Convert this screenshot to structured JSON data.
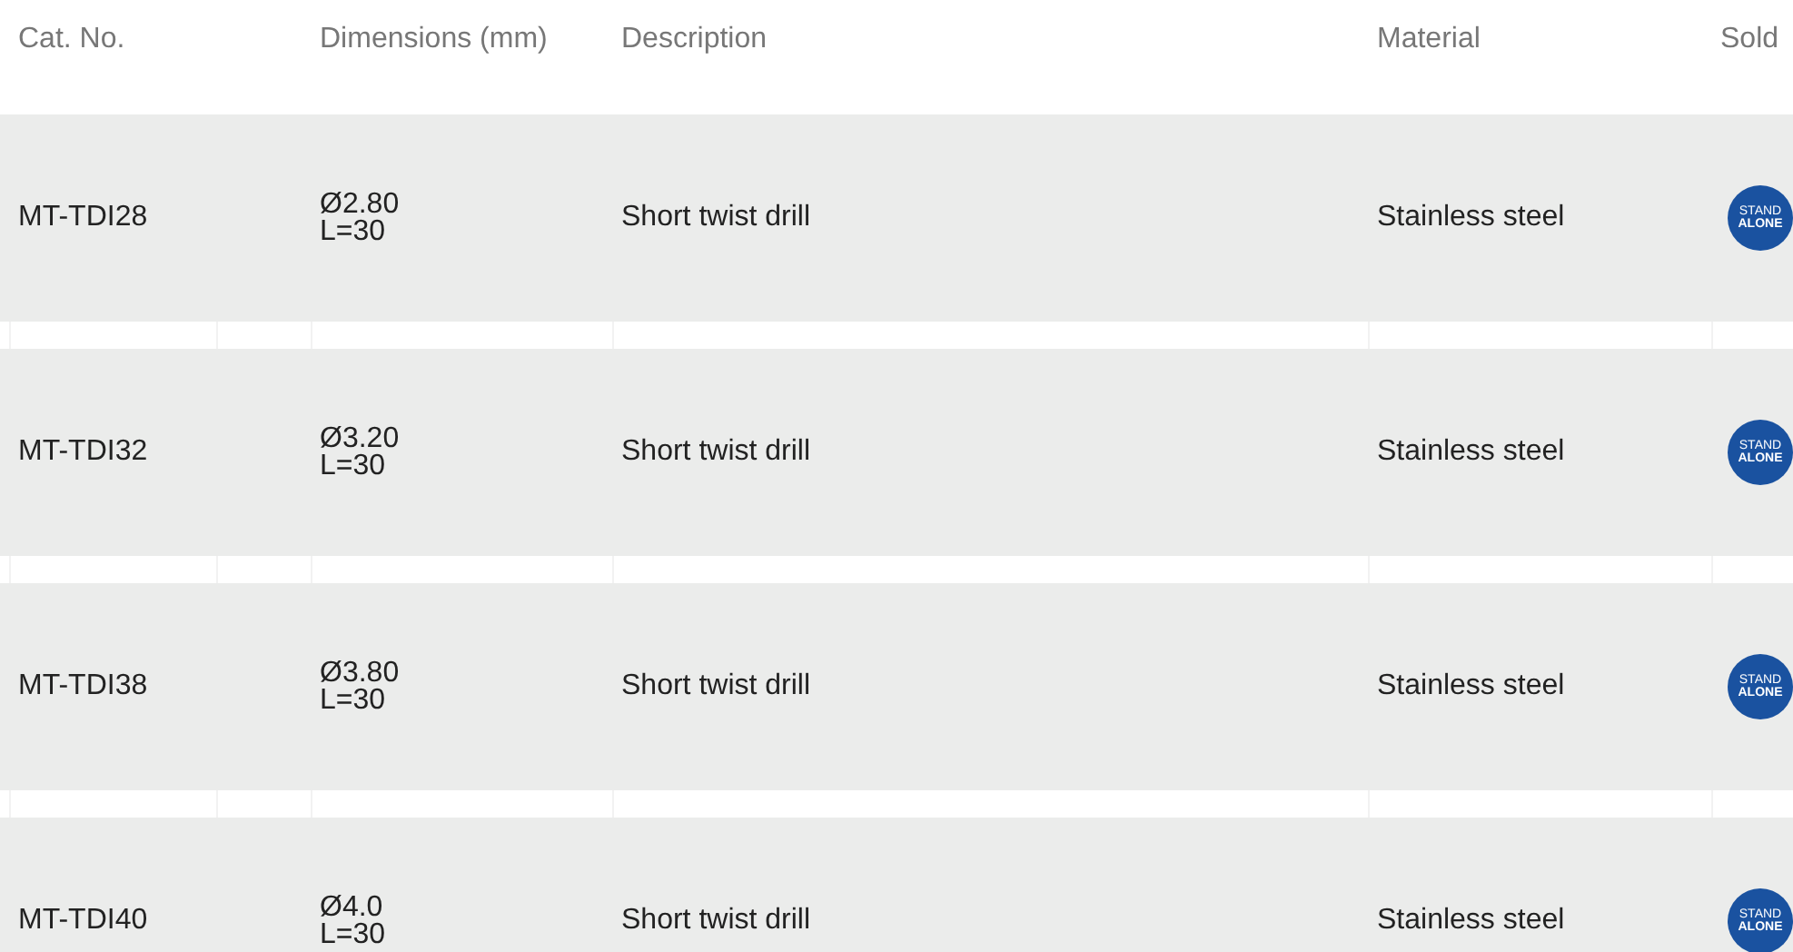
{
  "table": {
    "columns": [
      "Cat. No.",
      "Dimensions (mm)",
      "Description",
      "Material",
      "Sold"
    ],
    "rows": [
      {
        "cat_no": "MT-TDI28",
        "diameter": "Ø2.80",
        "length": "L=30",
        "description": "Short twist drill",
        "material": "Stainless steel",
        "sold": {
          "top": "STAND",
          "bottom": "ALONE"
        }
      },
      {
        "cat_no": "MT-TDI32",
        "diameter": "Ø3.20",
        "length": "L=30",
        "description": "Short twist drill",
        "material": "Stainless steel",
        "sold": {
          "top": "STAND",
          "bottom": "ALONE"
        }
      },
      {
        "cat_no": "MT-TDI38",
        "diameter": "Ø3.80",
        "length": "L=30",
        "description": "Short twist drill",
        "material": "Stainless steel",
        "sold": {
          "top": "STAND",
          "bottom": "ALONE"
        }
      },
      {
        "cat_no": "MT-TDI40",
        "diameter": "Ø4.0",
        "length": "L=30",
        "description": "Short twist drill",
        "material": "Stainless steel",
        "sold": {
          "top": "STAND",
          "bottom": "ALONE"
        }
      }
    ]
  }
}
